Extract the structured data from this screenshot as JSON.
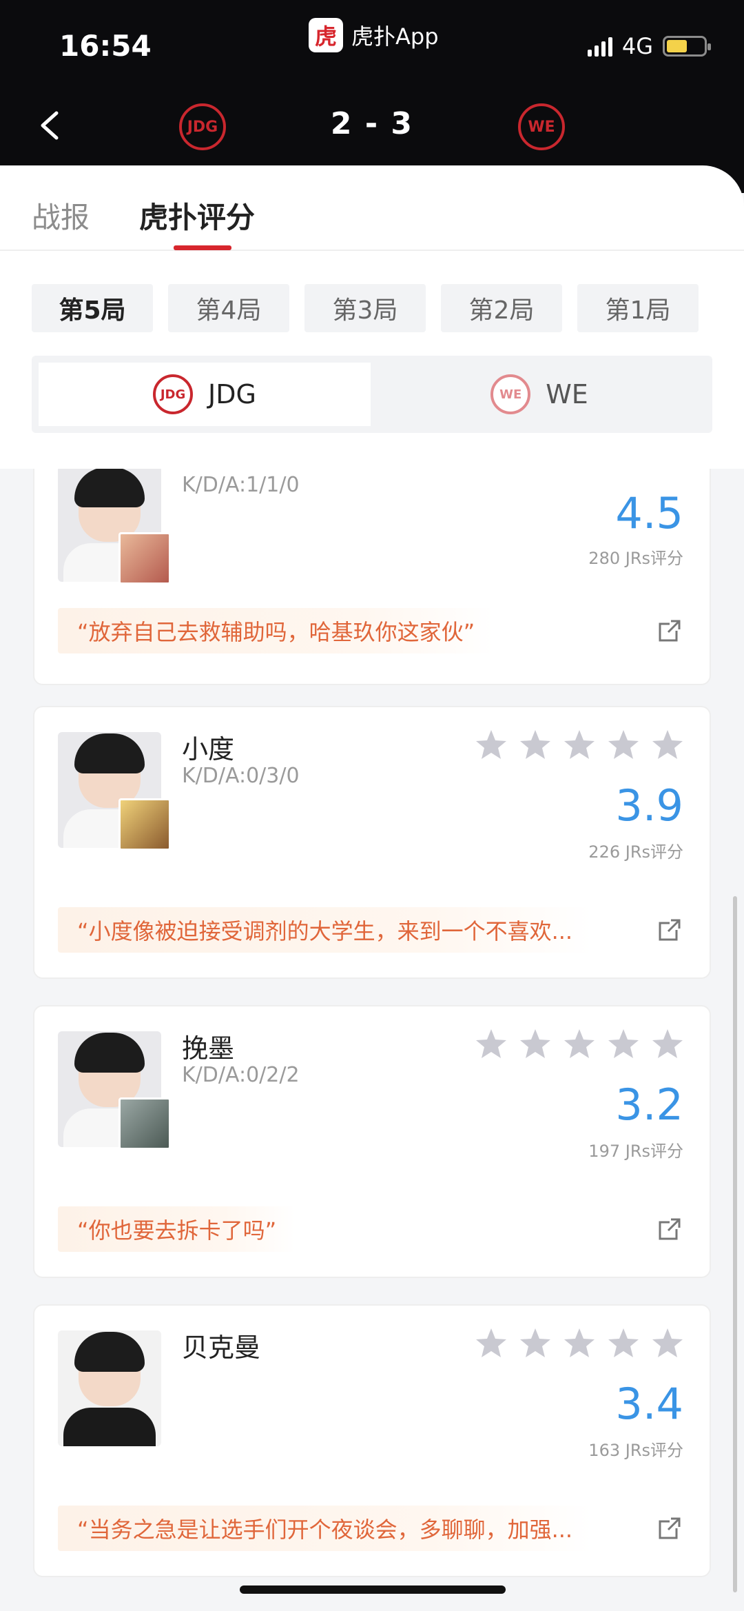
{
  "status_bar": {
    "time": "16:54",
    "network": "4G"
  },
  "app": {
    "logo_text": "虎",
    "name": "虎扑App"
  },
  "match": {
    "score": "2 - 3",
    "home_team": "JDG",
    "away_team": "WE",
    "home_logo": "JDG",
    "away_logo": "WE"
  },
  "tabs": [
    {
      "label": "战报"
    },
    {
      "label": "虎扑评分"
    }
  ],
  "games": [
    {
      "label": "第5局"
    },
    {
      "label": "第4局"
    },
    {
      "label": "第3局"
    },
    {
      "label": "第2局"
    },
    {
      "label": "第1局"
    }
  ],
  "team_switch": [
    {
      "label": "JDG",
      "selected": true
    },
    {
      "label": "WE",
      "selected": false
    }
  ],
  "players": [
    {
      "name": "",
      "kda": "K/D/A:1/1/0",
      "rating": "4.5",
      "votes": "280 JRs评分",
      "quote": "“放弃自己去救辅助吗，哈基玖你这家伙”",
      "stars_filled": 0
    },
    {
      "name": "小度",
      "kda": "K/D/A:0/3/0",
      "rating": "3.9",
      "votes": "226 JRs评分",
      "quote": "“小度像被迫接受调剂的大学生，来到一个不喜欢...",
      "stars_filled": 0
    },
    {
      "name": "挽墨",
      "kda": "K/D/A:0/2/2",
      "rating": "3.2",
      "votes": "197 JRs评分",
      "quote": "“你也要去拆卡了吗”",
      "stars_filled": 0
    },
    {
      "name": "贝克曼",
      "kda": "",
      "rating": "3.4",
      "votes": "163 JRs评分",
      "quote": "“当务之急是让选手们开个夜谈会，多聊聊，加强...",
      "stars_filled": 0
    }
  ],
  "colors": {
    "accent": "#d7262d",
    "rating_blue": "#3a94e5",
    "quote_orange": "#e0663a",
    "star_gray": "#c9c9d1"
  }
}
